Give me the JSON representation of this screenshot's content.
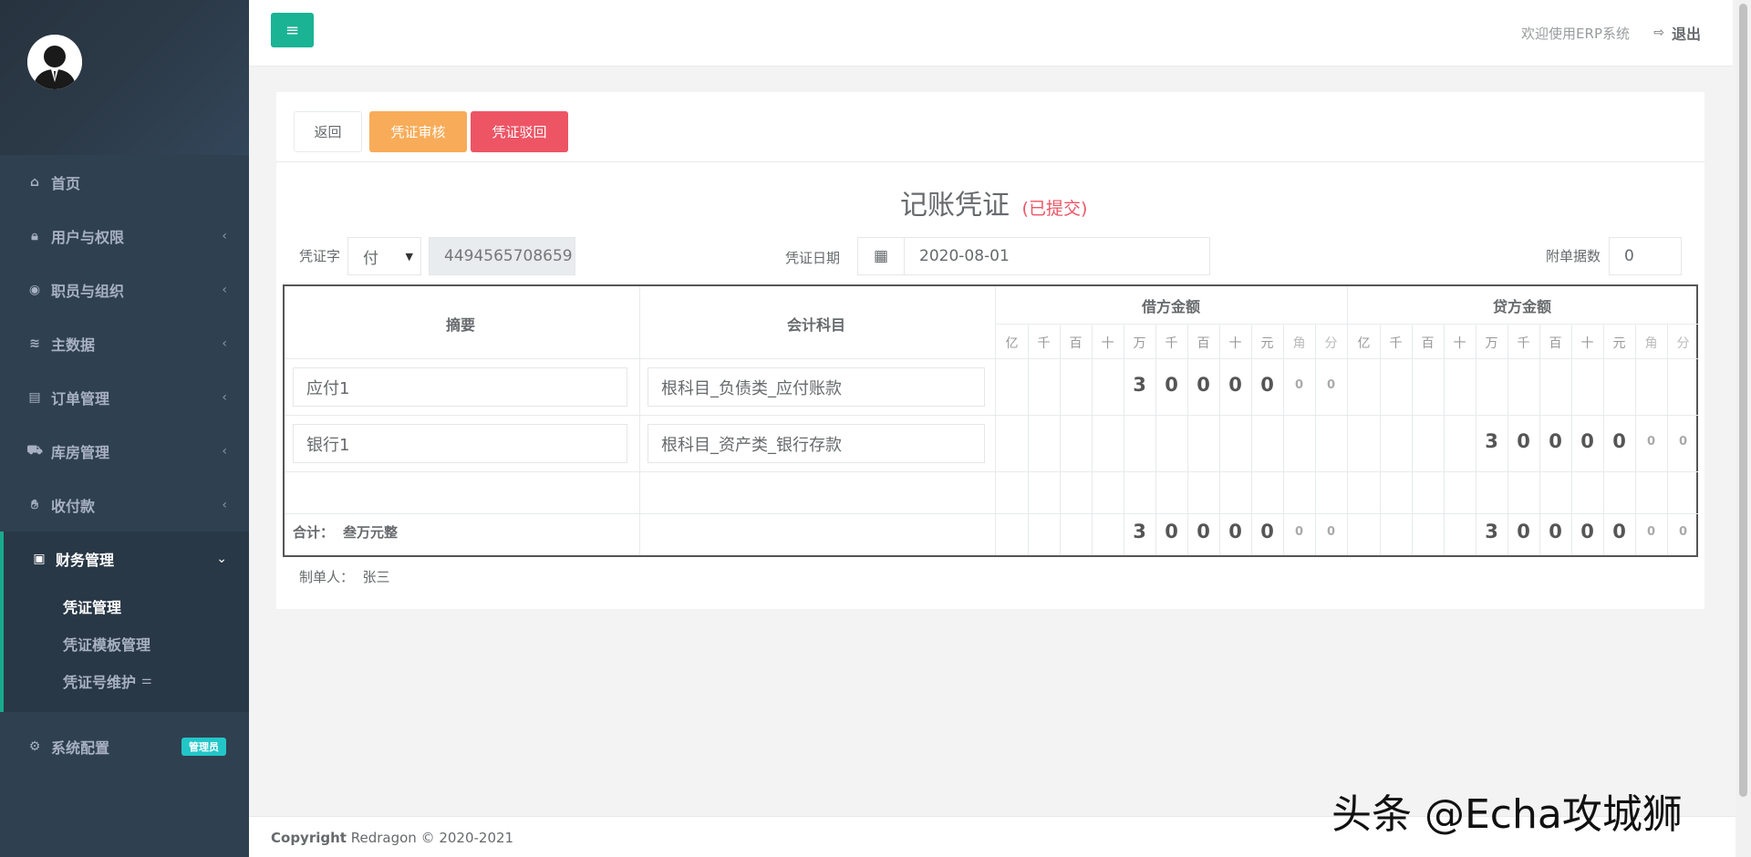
{
  "sidebar": {
    "items": [
      {
        "label": "首页",
        "icon": "home-icon"
      },
      {
        "label": "用户与权限",
        "icon": "lock-icon"
      },
      {
        "label": "职员与组织",
        "icon": "user-circle-icon"
      },
      {
        "label": "主数据",
        "icon": "database-icon"
      },
      {
        "label": "订单管理",
        "icon": "list-alt-icon"
      },
      {
        "label": "库房管理",
        "icon": "truck-icon"
      },
      {
        "label": "收付款",
        "icon": "handshake-icon"
      },
      {
        "label": "财务管理",
        "icon": "money-icon"
      },
      {
        "label": "系统配置",
        "icon": "gear-icon"
      }
    ],
    "finance_sub": [
      "凭证管理",
      "凭证模板管理",
      "凭证号维护"
    ],
    "admin_badge": "管理员"
  },
  "header": {
    "welcome": "欢迎使用ERP系统",
    "logout": "退出"
  },
  "toolbar": {
    "back": "返回",
    "audit": "凭证审核",
    "reject": "凭证驳回"
  },
  "voucher": {
    "title": "记账凭证",
    "status": "(已提交)",
    "word_label": "凭证字",
    "word_value": "付",
    "number": "4494565708659",
    "date_label": "凭证日期",
    "date": "2020-08-01",
    "attachments_label": "附单据数",
    "attachments": "0"
  },
  "table": {
    "headers": {
      "summary": "摘要",
      "account": "会计科目",
      "debit": "借方金额",
      "credit": "贷方金额"
    },
    "digit_units": [
      "亿",
      "千",
      "百",
      "十",
      "万",
      "千",
      "百",
      "十",
      "元",
      "角",
      "分"
    ],
    "rows": [
      {
        "summary": "应付1",
        "account": "根科目_负债类_应付账款",
        "debit": [
          "",
          "",
          "",
          "",
          "3",
          "0",
          "0",
          "0",
          "0",
          "0",
          "0"
        ],
        "credit": [
          "",
          "",
          "",
          "",
          "",
          "",
          "",
          "",
          "",
          "",
          ""
        ]
      },
      {
        "summary": "银行1",
        "account": "根科目_资产类_银行存款",
        "debit": [
          "",
          "",
          "",
          "",
          "",
          "",
          "",
          "",
          "",
          "",
          ""
        ],
        "credit": [
          "",
          "",
          "",
          "",
          "3",
          "0",
          "0",
          "0",
          "0",
          "0",
          "0"
        ]
      }
    ],
    "total_label": "合计：",
    "total_words": "叁万元整",
    "total_debit": [
      "",
      "",
      "",
      "",
      "3",
      "0",
      "0",
      "0",
      "0",
      "0",
      "0"
    ],
    "total_credit": [
      "",
      "",
      "",
      "",
      "3",
      "0",
      "0",
      "0",
      "0",
      "0",
      "0"
    ]
  },
  "creator": "制单人：  张三",
  "footer": {
    "brand": "Copyright",
    "text": " Redragon © 2020-2021"
  },
  "watermark": "头条 @Echa攻城狮",
  "colors": {
    "sidebar_bg": "#2f4050",
    "accent": "#1ab394",
    "audit": "#f8ac59",
    "reject": "#ed5565"
  }
}
